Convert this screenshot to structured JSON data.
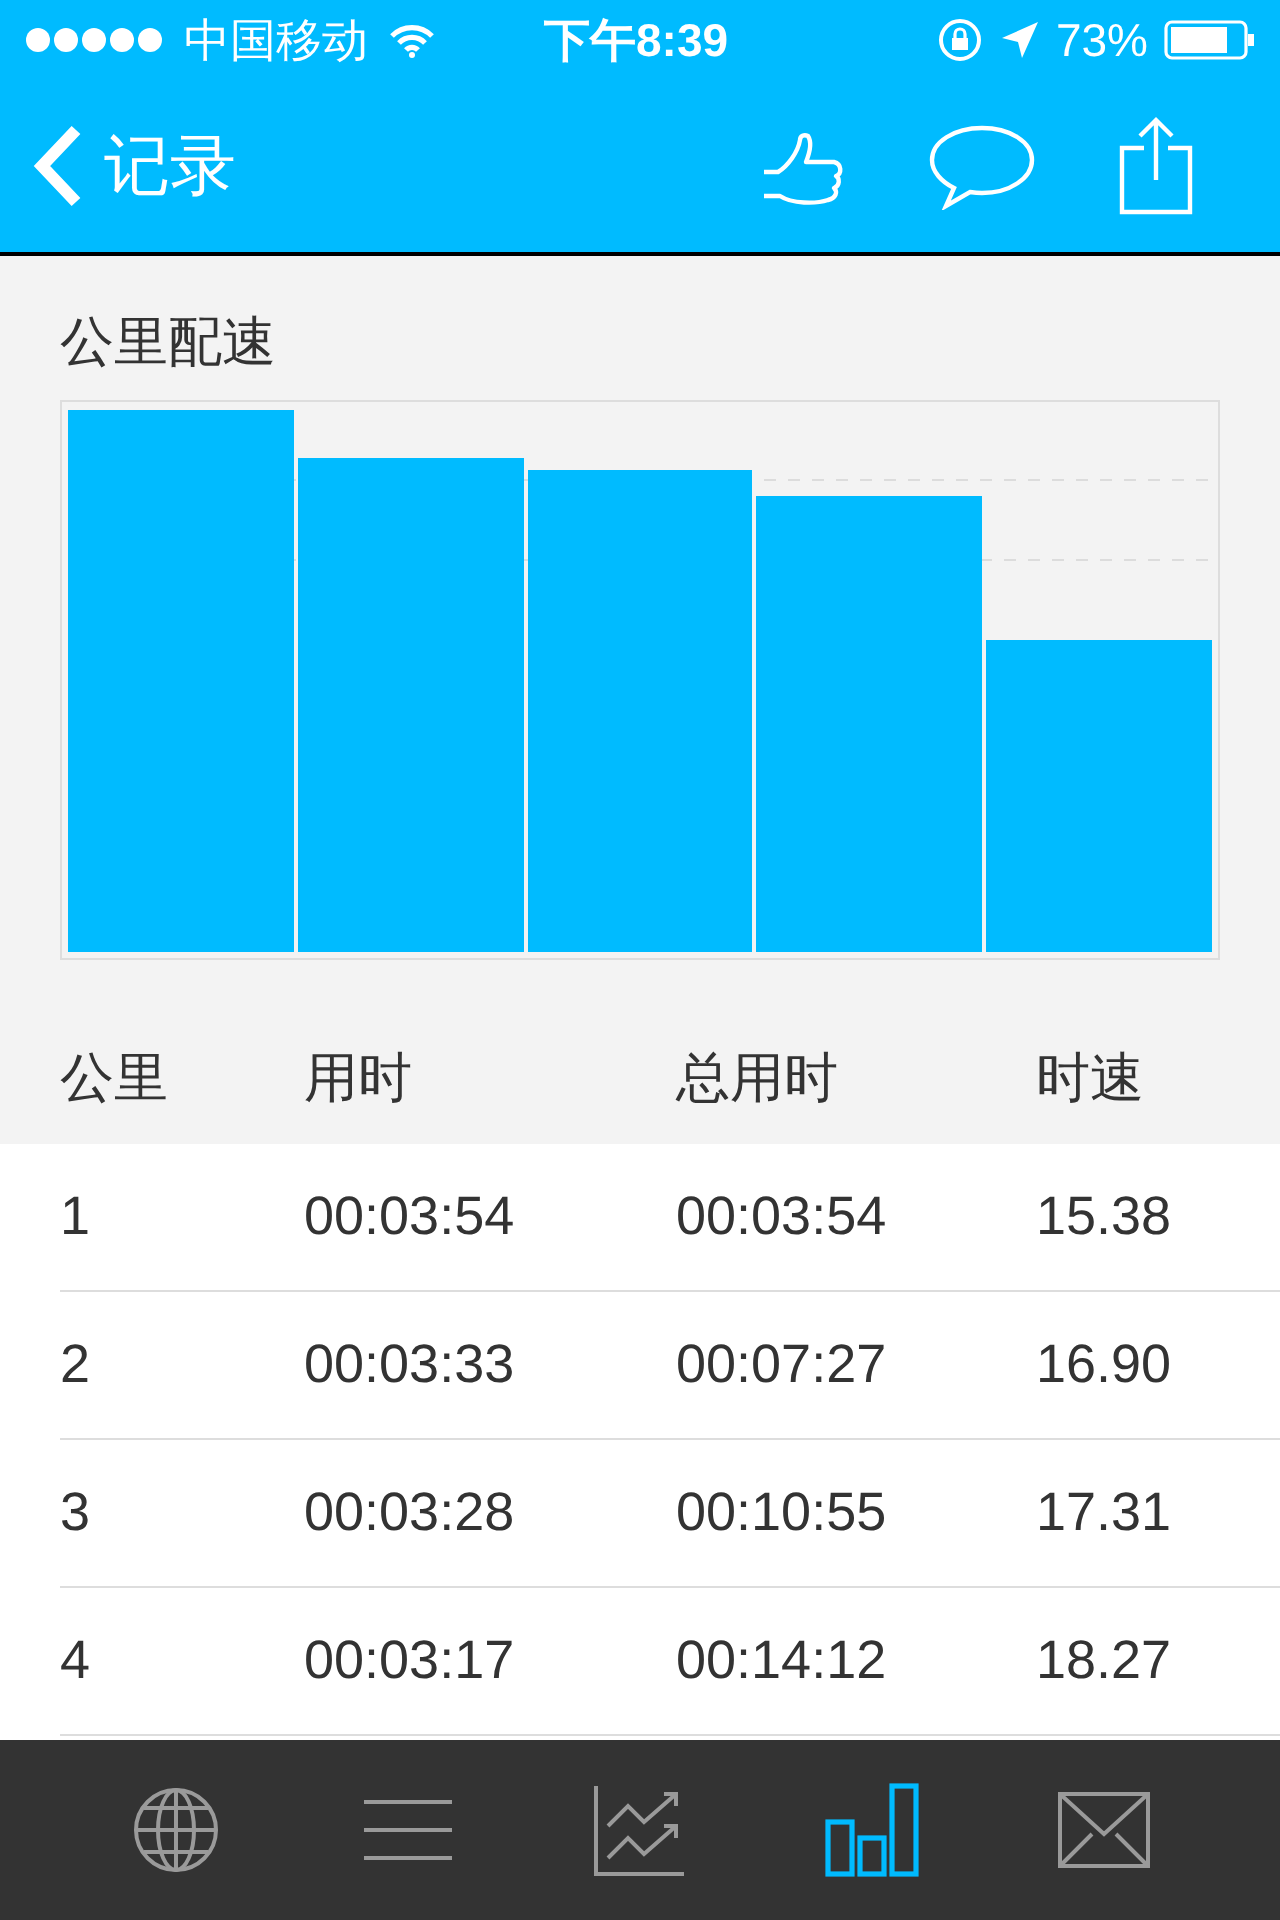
{
  "status_bar": {
    "carrier": "中国移动",
    "time": "下午8:39",
    "battery": "73%"
  },
  "nav_bar": {
    "back_label": "记录"
  },
  "chart": {
    "title": "公里配速"
  },
  "table": {
    "columns": [
      "公里",
      "用时",
      "总用时",
      "时速"
    ],
    "rows": [
      [
        "1",
        "00:03:54",
        "00:03:54",
        "15.38"
      ],
      [
        "2",
        "00:03:33",
        "00:07:27",
        "16.90"
      ],
      [
        "3",
        "00:03:28",
        "00:10:55",
        "17.31"
      ],
      [
        "4",
        "00:03:17",
        "00:14:12",
        "18.27"
      ]
    ]
  },
  "tab_bar": [
    {
      "kind": "globe",
      "selected": false
    },
    {
      "kind": "list",
      "selected": false
    },
    {
      "kind": "trend",
      "selected": false
    },
    {
      "kind": "bars",
      "selected": true
    },
    {
      "kind": "mail",
      "selected": false
    }
  ]
}
